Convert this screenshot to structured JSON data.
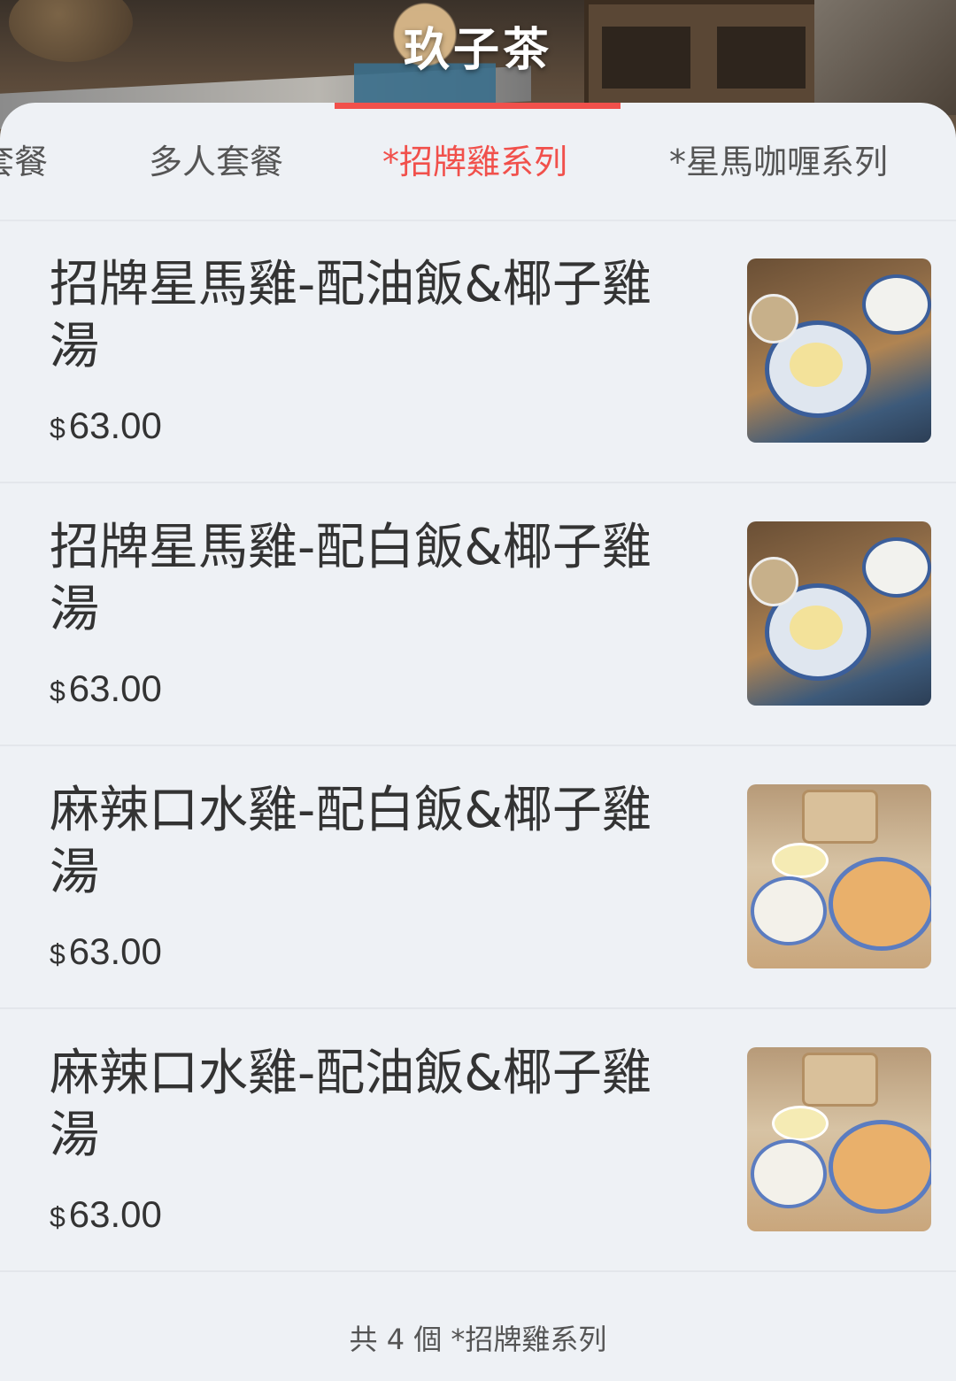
{
  "header": {
    "store_name": "玖子茶"
  },
  "tabs": [
    {
      "label": "套餐",
      "active": false
    },
    {
      "label": "多人套餐",
      "active": false
    },
    {
      "label": "*招牌雞系列",
      "active": true
    },
    {
      "label": "*星馬咖喱系列",
      "active": false
    }
  ],
  "accent_color": "#f1504b",
  "items": [
    {
      "name": "招牌星馬雞-配油飯&椰子雞湯",
      "currency": "$",
      "price": "63.00",
      "image": "hainanese-chicken-photo"
    },
    {
      "name": "招牌星馬雞-配白飯&椰子雞湯",
      "currency": "$",
      "price": "63.00",
      "image": "hainanese-chicken-photo"
    },
    {
      "name": "麻辣口水雞-配白飯&椰子雞湯",
      "currency": "$",
      "price": "63.00",
      "image": "spicy-chicken-photo"
    },
    {
      "name": "麻辣口水雞-配油飯&椰子雞湯",
      "currency": "$",
      "price": "63.00",
      "image": "spicy-chicken-photo"
    }
  ],
  "footer": {
    "summary": "共 4 個 *招牌雞系列"
  }
}
